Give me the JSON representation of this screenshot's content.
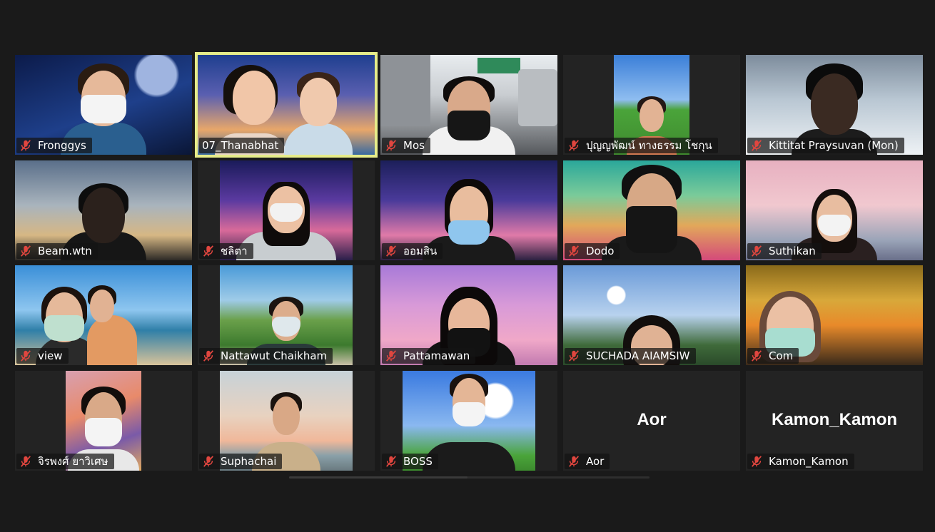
{
  "participants": [
    {
      "name": "Fronggys",
      "muted": true,
      "active": false
    },
    {
      "name": "07_Thanabhat",
      "muted": false,
      "active": true
    },
    {
      "name": "Mos",
      "muted": true,
      "active": false
    },
    {
      "name": "ปุญญพัฒน์ ทางธรรม โชกุน",
      "muted": true,
      "active": false
    },
    {
      "name": "Kittitat Praysuvan (Mon)",
      "muted": true,
      "active": false
    },
    {
      "name": "Beam.wtn",
      "muted": true,
      "active": false
    },
    {
      "name": "ชลิตา",
      "muted": true,
      "active": false
    },
    {
      "name": "ออมสิน",
      "muted": true,
      "active": false
    },
    {
      "name": "Dodo",
      "muted": true,
      "active": false
    },
    {
      "name": "Suthikan",
      "muted": true,
      "active": false
    },
    {
      "name": "view",
      "muted": true,
      "active": false
    },
    {
      "name": "Nattawut Chaikham",
      "muted": true,
      "active": false
    },
    {
      "name": "Pattamawan",
      "muted": true,
      "active": false
    },
    {
      "name": "SUCHADA AIAMSIW",
      "muted": true,
      "active": false
    },
    {
      "name": "Com",
      "muted": true,
      "active": false
    },
    {
      "name": "จิรพงศ์ ยาวิเศษ",
      "muted": true,
      "active": false
    },
    {
      "name": "Suphachai",
      "muted": true,
      "active": false
    },
    {
      "name": "BOSS",
      "muted": true,
      "active": false
    },
    {
      "name": "Aor",
      "muted": true,
      "active": false,
      "video_off": true,
      "display_label": "Aor"
    },
    {
      "name": "Kamon_Kamon",
      "muted": true,
      "active": false,
      "video_off": true,
      "display_label": "Kamon_Kamon"
    }
  ],
  "icons": {
    "muted": "mic-off-icon"
  },
  "colors": {
    "active_border": "#e6ec8a",
    "mute_icon": "#e0463f",
    "tile_bg": "#232323",
    "page_bg": "#1a1a1a"
  }
}
